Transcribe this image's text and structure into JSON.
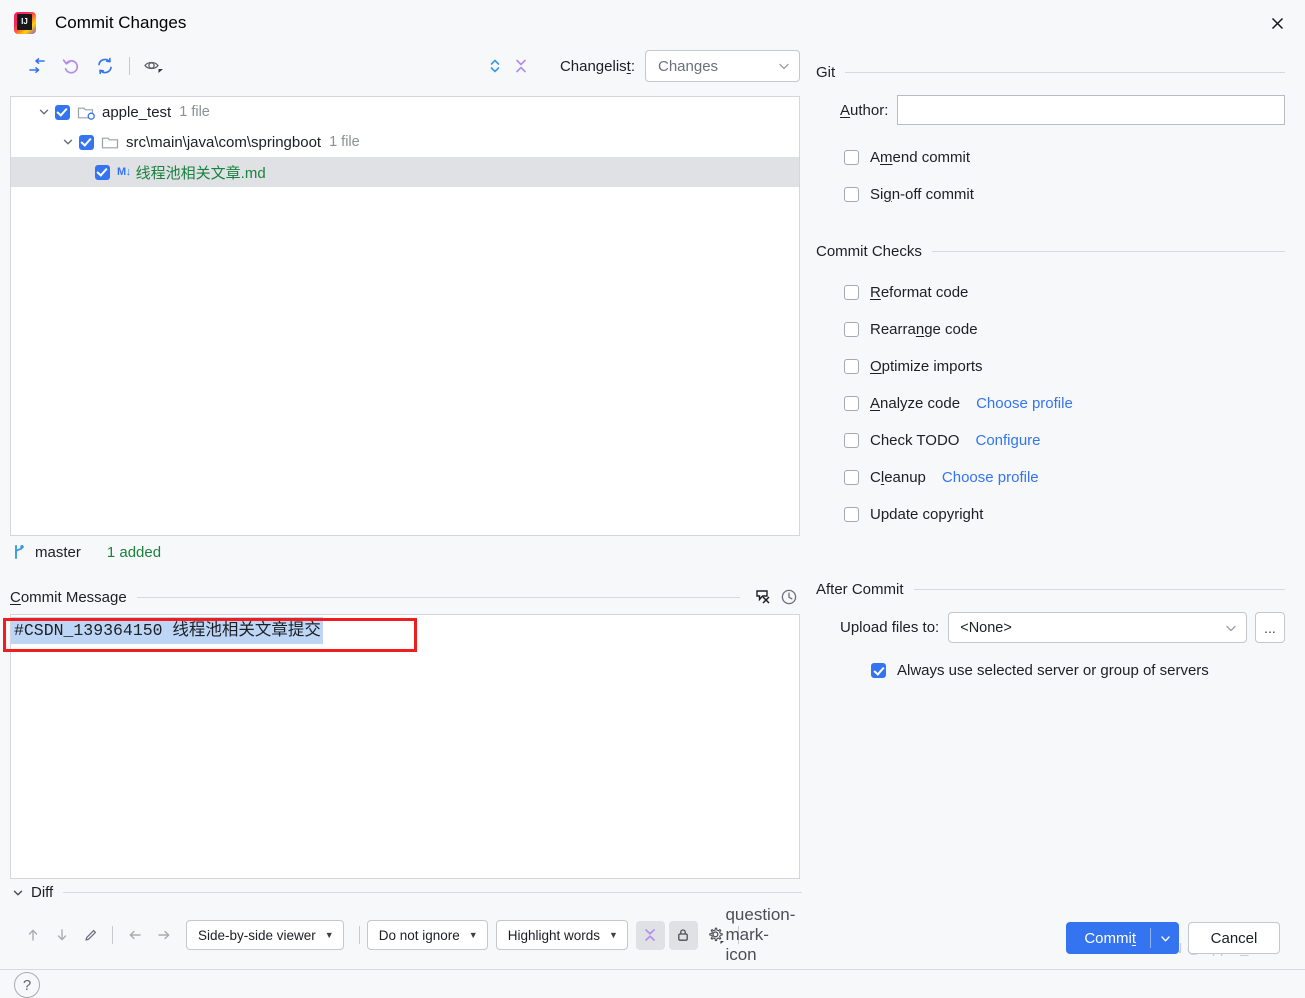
{
  "window": {
    "title": "Commit Changes",
    "logo_icon": "intellij-idea-logo",
    "close_icon": "close-icon"
  },
  "toolbar": {
    "icons": [
      {
        "name": "rollback-arrow-icon",
        "title": "Revert"
      },
      {
        "name": "undo-icon",
        "title": "Rollback"
      },
      {
        "name": "refresh-icon",
        "title": "Refresh"
      },
      {
        "name": "preview-eye-icon",
        "title": "Preview Diff"
      }
    ],
    "expand_icon": "expand-collapse-icon",
    "collapse_icon": "collapse-all-icon",
    "changelist_label": "Changelist:",
    "changelist_value": "Changes"
  },
  "tree": {
    "nodes": [
      {
        "name": "apple_test",
        "count": "1 file",
        "icon": "repository-folder-icon",
        "checked": true,
        "expanded": true,
        "selected": false,
        "indent": 0
      },
      {
        "name": "src\\main\\java\\com\\springboot",
        "count": "1 file",
        "icon": "folder-icon",
        "checked": true,
        "expanded": true,
        "selected": false,
        "indent": 1
      },
      {
        "name": "线程池相关文章.md",
        "count": "",
        "icon": "markdown-file-icon",
        "checked": true,
        "selected": true,
        "indent": 2,
        "status": "added"
      }
    ]
  },
  "status": {
    "branch_icon": "git-branch-icon",
    "branch": "master",
    "added_text": "1 added"
  },
  "commit_message": {
    "section_label_prefix": "C",
    "section_label_rest": "ommit Message",
    "text": "#CSDN_139364150 线程池相关文章提交",
    "spellcheck_icon": "spellcheck-icon",
    "history_icon": "history-clock-icon"
  },
  "diff": {
    "section_label": "Diff",
    "collapse_icon": "chevron-down-icon",
    "nav_up_icon": "arrow-up-icon",
    "nav_down_icon": "arrow-down-icon",
    "edit_icon": "pencil-icon",
    "prev_icon": "arrow-left-icon",
    "next_icon": "arrow-right-icon",
    "viewer_mode": "Side-by-side viewer",
    "ignore_mode": "Do not ignore",
    "highlight_mode": "Highlight words",
    "collapse_unchanged_icon": "collapse-x-icon",
    "lock_icon": "lock-icon",
    "settings_icon": "gear-icon",
    "help_icon": "question-mark-icon"
  },
  "git_section": {
    "title": "Git",
    "author_label_mnemonic": "A",
    "author_label_rest": "uthor:",
    "author_value": "",
    "checkboxes": [
      {
        "pre": "A",
        "mn": "m",
        "post": "end commit",
        "checked": false,
        "name": "amend-commit"
      },
      {
        "pre": "Si",
        "mn": "g",
        "post": "n-off commit",
        "checked": false,
        "name": "sign-off-commit"
      }
    ]
  },
  "commit_checks": {
    "title": "Commit Checks",
    "items": [
      {
        "pre": "",
        "mn": "R",
        "post": "eformat code",
        "checked": false,
        "link": "",
        "name": "reformat-code"
      },
      {
        "pre": "Rearra",
        "mn": "n",
        "post": "ge code",
        "checked": false,
        "link": "",
        "name": "rearrange-code"
      },
      {
        "pre": "",
        "mn": "O",
        "post": "ptimize imports",
        "checked": false,
        "link": "",
        "name": "optimize-imports"
      },
      {
        "pre": "",
        "mn": "A",
        "post": "nalyze code",
        "checked": false,
        "link": "Choose profile",
        "name": "analyze-code"
      },
      {
        "pre": "Check TODO",
        "mn": "",
        "post": "",
        "checked": false,
        "link": "Configure",
        "name": "check-todo"
      },
      {
        "pre": "C",
        "mn": "l",
        "post": "eanup",
        "checked": false,
        "link": "Choose profile",
        "name": "cleanup"
      },
      {
        "pre": "Update copyright",
        "mn": "",
        "post": "",
        "checked": false,
        "link": "",
        "name": "update-copyright"
      }
    ]
  },
  "after_commit": {
    "title": "After Commit",
    "upload_label": "Upload files to:",
    "upload_value": "<None>",
    "ellipsis_label": "...",
    "always_use_label": "Always use selected server or group of servers",
    "always_use_checked": true
  },
  "footer": {
    "help_label": "?",
    "commit_pre": "Commi",
    "commit_mn": "t",
    "cancel_label": "Cancel",
    "watermark": "CSDN @Apple_Web"
  },
  "colors": {
    "accent": "#3574f0",
    "added_green": "#18833d",
    "link_blue": "#3574f0",
    "selection_blue": "#bdd6f5",
    "annotation_red": "#ef1d1d",
    "panel_bg": "#f7f8fa"
  }
}
